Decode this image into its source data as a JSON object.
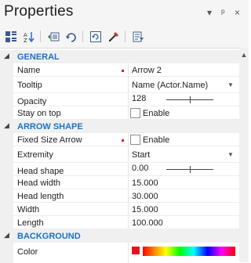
{
  "panel": {
    "title": "Properties",
    "window_buttons": {
      "dropdown": "▾",
      "pin": "ᵖ",
      "close": "×"
    }
  },
  "toolbar": {
    "buttons": [
      {
        "name": "categorized-icon"
      },
      {
        "name": "sort-alphabetical-icon"
      },
      {
        "name": "expand-all-icon"
      },
      {
        "name": "collapse-all-icon"
      },
      {
        "name": "reset-icon"
      },
      {
        "name": "eyedropper-icon"
      },
      {
        "name": "property-pages-icon"
      }
    ]
  },
  "categories": {
    "general": "GENERAL",
    "arrow_shape": "ARROW SHAPE",
    "background": "BACKGROUND"
  },
  "general": {
    "name": {
      "label": "Name",
      "value": "Arrow 2"
    },
    "tooltip": {
      "label": "Tooltip",
      "value": "Name (Actor.Name)"
    },
    "opacity": {
      "label": "Opacity",
      "value": "128",
      "level": 0.5
    },
    "stay_on_top": {
      "label": "Stay on top",
      "checkbox_label": "Enable",
      "checked": false
    }
  },
  "arrow_shape": {
    "fixed_size_arrow": {
      "label": "Fixed Size Arrow",
      "checkbox_label": "Enable",
      "checked": false
    },
    "extremity": {
      "label": "Extremity",
      "value": "Start"
    },
    "head_shape": {
      "label": "Head shape",
      "value": "0.00",
      "level": 0.5
    },
    "head_width": {
      "label": "Head width",
      "value": "15.000"
    },
    "head_length": {
      "label": "Head length",
      "value": "30.000"
    },
    "width": {
      "label": "Width",
      "value": "15.000"
    },
    "length": {
      "label": "Length",
      "value": "100.000"
    }
  },
  "background": {
    "color": {
      "label": "Color",
      "swatch": "#e81123"
    }
  },
  "colors": {
    "category_text": "#1a73c8",
    "marker": "#e81123"
  }
}
